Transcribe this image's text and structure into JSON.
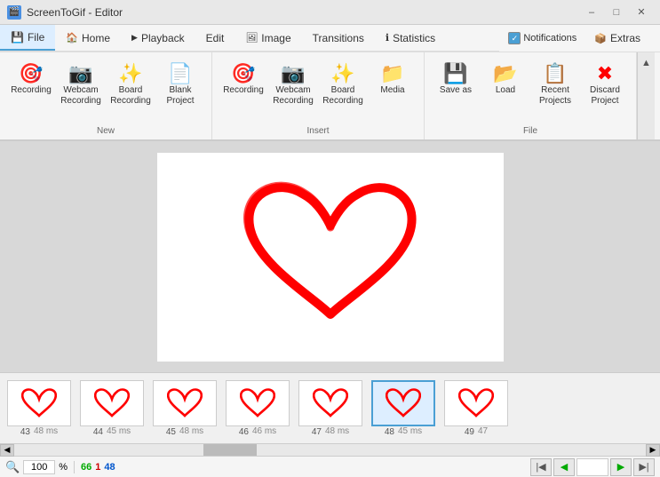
{
  "titlebar": {
    "icon_text": "S",
    "title": "ScreenToGif - Editor",
    "btn_minimize": "–",
    "btn_maximize": "□",
    "btn_close": "✕"
  },
  "menu": {
    "tabs": [
      {
        "id": "file",
        "label": "File",
        "active": true,
        "icon": "💾"
      },
      {
        "id": "home",
        "label": "Home",
        "active": false,
        "icon": "🏠"
      },
      {
        "id": "playback",
        "label": "Playback",
        "active": false,
        "icon": "▶"
      },
      {
        "id": "edit",
        "label": "Edit",
        "active": false,
        "icon": ""
      },
      {
        "id": "image",
        "label": "Image",
        "active": false,
        "icon": "🖼"
      },
      {
        "id": "transitions",
        "label": "Transitions",
        "active": false,
        "icon": ""
      },
      {
        "id": "statistics",
        "label": "Statistics",
        "active": false,
        "icon": "ℹ"
      },
      {
        "id": "notifications",
        "label": "Notifications",
        "active": false,
        "icon": ""
      },
      {
        "id": "extras",
        "label": "Extras",
        "active": false,
        "icon": ""
      }
    ]
  },
  "ribbon": {
    "groups": [
      {
        "id": "new",
        "label": "New",
        "items": [
          {
            "id": "recording",
            "icon": "🎯",
            "label": "Recording"
          },
          {
            "id": "webcam",
            "icon": "📷",
            "label": "Webcam\nRecording"
          },
          {
            "id": "board",
            "icon": "✨",
            "label": "Board\nRecording"
          },
          {
            "id": "blank",
            "icon": "📄",
            "label": "Blank\nProject"
          }
        ]
      },
      {
        "id": "insert",
        "label": "Insert",
        "items": [
          {
            "id": "recording2",
            "icon": "🎯",
            "label": "Recording"
          },
          {
            "id": "webcam2",
            "icon": "📷",
            "label": "Webcam\nRecording"
          },
          {
            "id": "board2",
            "icon": "✨",
            "label": "Board\nRecording"
          },
          {
            "id": "media",
            "icon": "📁",
            "label": "Media"
          }
        ]
      },
      {
        "id": "file",
        "label": "File",
        "items": [
          {
            "id": "saveas",
            "icon": "💾",
            "label": "Save as"
          },
          {
            "id": "load",
            "icon": "📂",
            "label": "Load"
          },
          {
            "id": "recent",
            "icon": "📋",
            "label": "Recent\nProjects"
          },
          {
            "id": "discard",
            "icon": "✖",
            "label": "Discard\nProject"
          }
        ]
      }
    ],
    "notifications": {
      "label": "Notifications",
      "checked": true
    },
    "extras": {
      "label": "Extras",
      "icon": "📦"
    }
  },
  "frames": [
    {
      "num": "43",
      "ms": "48 ms",
      "selected": false
    },
    {
      "num": "44",
      "ms": "45 ms",
      "selected": false
    },
    {
      "num": "45",
      "ms": "48 ms",
      "selected": false
    },
    {
      "num": "46",
      "ms": "46 ms",
      "selected": false
    },
    {
      "num": "47",
      "ms": "48 ms",
      "selected": false
    },
    {
      "num": "48",
      "ms": "45 ms",
      "selected": true
    },
    {
      "num": "49",
      "ms": "47",
      "selected": false
    }
  ],
  "statusbar": {
    "search_placeholder": "100",
    "zoom_percent": "100",
    "zoom_symbol": "%",
    "frame_green": "66",
    "frame_red": "1",
    "frame_blue": "48"
  }
}
